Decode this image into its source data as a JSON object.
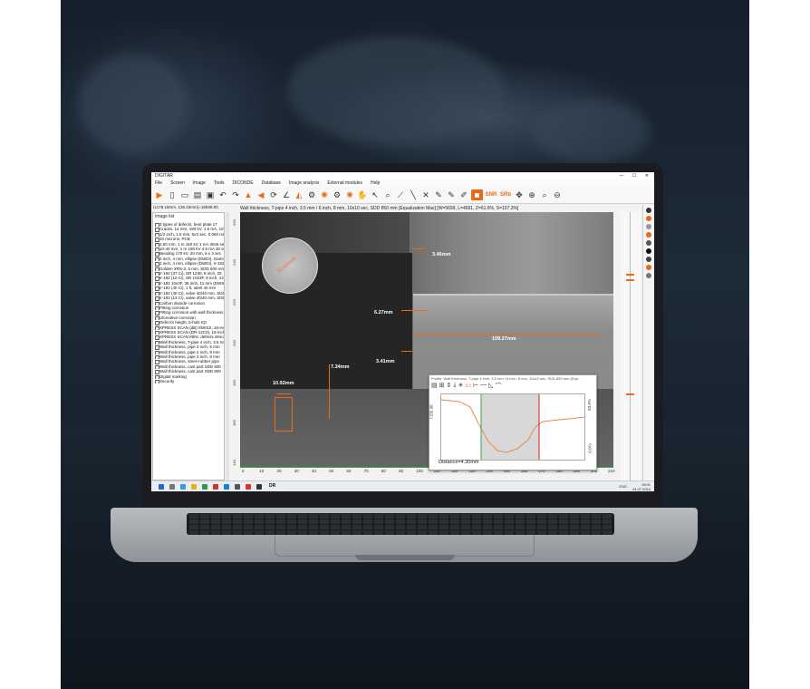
{
  "app": {
    "title": "DIGITAR",
    "window_controls": "— ☐ ✕",
    "menu": [
      "File",
      "Screen",
      "Image",
      "Tools",
      "DICONDE",
      "Database",
      "Image analysis",
      "External modules",
      "Help"
    ],
    "toolbar_text": {
      "snr": "SNR",
      "srb": "SRb"
    },
    "status": "(x178.18mm, 136.15mm)=16839.00",
    "image_title": "Wall thickness, T-pipe 4 inch, 3.5 mm / 6 inch, 8 mm, 10x10 sec, SDD 850 mm [Equalization Max] [W=5699, L=4691, Z=61.6%, S=107.3%]"
  },
  "left_panel": {
    "label": "Image list",
    "items": [
      "3 types of defects, bent plate 17",
      "Cracks, 14 mm, 180 kV, 1.5 mA, 10",
      "1/2 inch, 1.5 mm, 5x3 sec, 0.060 mm",
      "10 microns; PCB",
      "2.00 mm, 1 m 150 kV 1 mA 30x5 sec",
      "10-40 mm, 1 m 180 kV 4.5 mA 30 sec",
      "Bending 170 kV, 20 mm, 5 x 3 sec",
      "2 inch, 4 mm, ellipse (DWDI), Gamma",
      "2 inch, 4 mm, ellipse (DWDI), Ir-192",
      "Golden XRS-3, 6 mm, SDD 600 mm",
      "Ir-192 (37 Ci), SR 1230, 8 inch, 20",
      "Ir-192 (10 Ci), SR 1023F, 8 inch, 14",
      "Ir-192 10x3F, 36 inch, 11 mm (DWSI)",
      "Ir-192 (40 Ci), 1 ft, steel 40 mm",
      "Ir-192 (40 Ci), valve 40/40 mm, SDD",
      "Ir-192 (13 Ci), valve 40/40 mm, SDD",
      "Carbon dioxide corrosion",
      "Pitting corrosion",
      "Pitting corrosion with wall thickness",
      "Ulcerative corrosion",
      "Defect's height, 5-hole IQI",
      "XPRESS SCAN (dB) SWISS, 16-inch",
      "XPRESS SCAN (DR-12C0), 16-inch",
      "XPRESS SCAN MINI, defects descr.",
      "Wall thickness, T-pipe 4 inch, 3.5 mm",
      "Wall thickness, pipe 2 inch, 5 mm",
      "Wall thickness, pipe 2 inch, 9 mm",
      "Wall thickness, pipe 3 inch, 8 mm",
      "Wall thickness, steel+rubber pipe",
      "Wall thickness, cast part SDD 600",
      "Wall thickness, cast part SDD 800",
      "Digital marking",
      "Security"
    ]
  },
  "viewer": {
    "iqi_label": "30.60mm",
    "measurements": [
      "3.46mm",
      "6.27mm",
      "109.27mm",
      "3.41mm",
      "7.34mm",
      "10.92mm"
    ],
    "y_ticks": [
      "260",
      "240",
      "220",
      "200",
      "180",
      "160",
      "140"
    ],
    "x_ticks": [
      "0",
      "10",
      "20",
      "30",
      "40",
      "50",
      "60",
      "70",
      "80",
      "90",
      "100",
      "110",
      "120",
      "130",
      "140",
      "150",
      "160",
      "170",
      "180",
      "190",
      "200",
      "210"
    ]
  },
  "profile": {
    "title": "Profile: Wall thickness, T-pipe 4 inch, 3.5 mm / 6 inch, 8 mm, 10x10 sec, SDD 850 mm (Equ...",
    "tools": [
      "▤",
      "⊞",
      "⇕",
      "⤓",
      "✳",
      "▭",
      "⊢",
      "—",
      "◺",
      "⌒"
    ],
    "y_left": "7155.98",
    "y_right_top": "63.9%",
    "y_right_bottom": "0.0%",
    "distance": "Distance=4.30mm"
  },
  "taskbar": {
    "lang": "ENG",
    "time": "19:01",
    "date": "24.07.2024",
    "dr_label": "DR"
  },
  "colors": {
    "accent": "#e86a1a",
    "axis": "#33aa33"
  }
}
